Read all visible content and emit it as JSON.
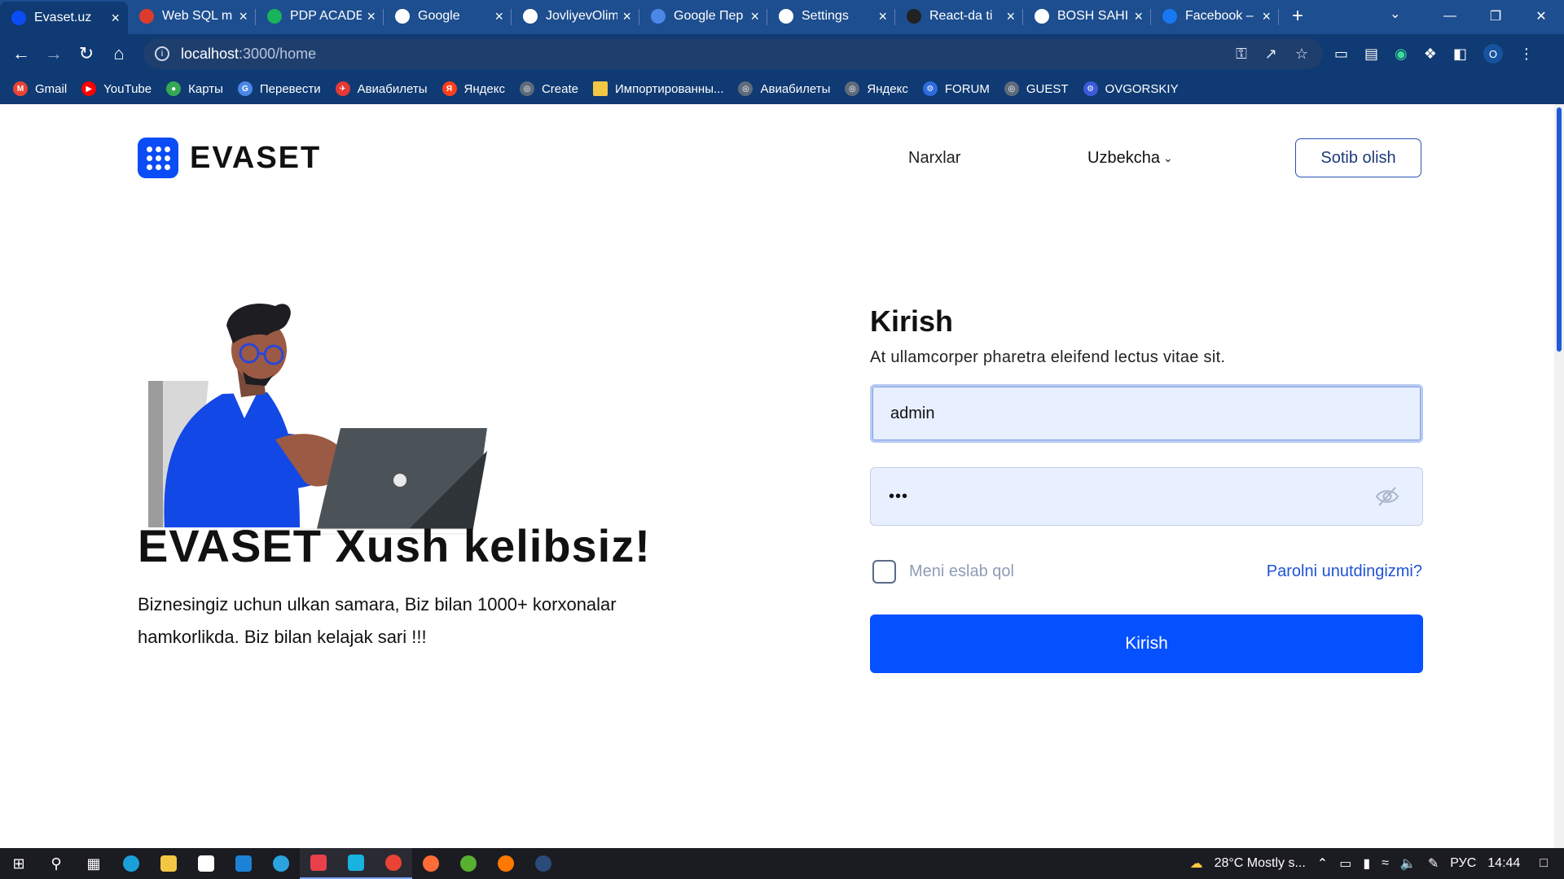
{
  "browser": {
    "tabs": [
      {
        "label": "Evaset.uz",
        "icon": "evaset-favicon",
        "color": "#0a4cf5",
        "active": true
      },
      {
        "label": "Web SQL m",
        "icon": "chrome-icon",
        "color": "#dd3b2c"
      },
      {
        "label": "PDP ACADE",
        "icon": "pdp-dot-icon",
        "color": "#18b35b"
      },
      {
        "label": "Google",
        "icon": "google-icon",
        "color": "#ffffff"
      },
      {
        "label": "JovliyevOlim",
        "icon": "github-icon",
        "color": "#ffffff"
      },
      {
        "label": "Google Пер",
        "icon": "google-translate-icon",
        "color": "#4a87e8"
      },
      {
        "label": "Settings",
        "icon": "gear-icon",
        "color": "#ffffff"
      },
      {
        "label": "React-da ti",
        "icon": "react-icon",
        "color": "#222222"
      },
      {
        "label": "BOSH SAHI",
        "icon": "globe-icon",
        "color": "#ffffff"
      },
      {
        "label": "Facebook –",
        "icon": "facebook-icon",
        "color": "#1877f2"
      }
    ],
    "url_host": "localhost",
    "url_path": ":3000/home",
    "bookmarks": [
      {
        "label": "Gmail",
        "icon": "gmail-icon",
        "color": "#ea4335",
        "glyph": "M"
      },
      {
        "label": "YouTube",
        "icon": "youtube-icon",
        "color": "#ff0000",
        "glyph": "▶"
      },
      {
        "label": "Карты",
        "icon": "maps-icon",
        "color": "#34a853",
        "glyph": "●"
      },
      {
        "label": "Перевести",
        "icon": "translate-icon",
        "color": "#4a87e8",
        "glyph": "G"
      },
      {
        "label": "Авиабилеты",
        "icon": "flights-icon",
        "color": "#e53935",
        "glyph": "✈"
      },
      {
        "label": "Яндекс",
        "icon": "yandex-icon",
        "color": "#fc3f1d",
        "glyph": "Я"
      },
      {
        "label": "Create",
        "icon": "globe-icon",
        "color": "#5f6b7a",
        "glyph": "◎"
      },
      {
        "label": "Импортированны...",
        "icon": "folder-icon",
        "color": "#f2c744",
        "glyph": ""
      },
      {
        "label": "Авиабилеты",
        "icon": "globe-icon",
        "color": "#5f6b7a",
        "glyph": "◎"
      },
      {
        "label": "Яндекс",
        "icon": "globe-icon",
        "color": "#5f6b7a",
        "glyph": "◎"
      },
      {
        "label": "FORUM",
        "icon": "forum-icon",
        "color": "#2d6cdf",
        "glyph": "⚙"
      },
      {
        "label": "GUEST",
        "icon": "globe-icon",
        "color": "#5f6b7a",
        "glyph": "◎"
      },
      {
        "label": "OVGORSKIY",
        "icon": "ovgorskiy-icon",
        "color": "#3b5bdb",
        "glyph": "⚙"
      }
    ],
    "profile_initial": "O"
  },
  "header": {
    "logo_text": "EVASET",
    "nav_prices": "Narxlar",
    "language": "Uzbekcha",
    "buy_button": "Sotib olish"
  },
  "hero": {
    "title": "EVASET Xush kelibsiz!",
    "text": "Biznesingiz uchun ulkan samara, Biz bilan 1000+ korxonalar hamkorlikda. Biz bilan kelajak sari !!!"
  },
  "login": {
    "title": "Kirish",
    "subtitle": "At ullamcorper pharetra eleifend lectus vitae sit.",
    "username_value": "admin",
    "password_value": "•••",
    "remember_label": "Meni eslab qol",
    "forgot_link": "Parolni unutdingizmi?",
    "submit_label": "Kirish"
  },
  "taskbar": {
    "weather": "28°C  Mostly s...",
    "language": "РУС",
    "time": "14:44"
  }
}
